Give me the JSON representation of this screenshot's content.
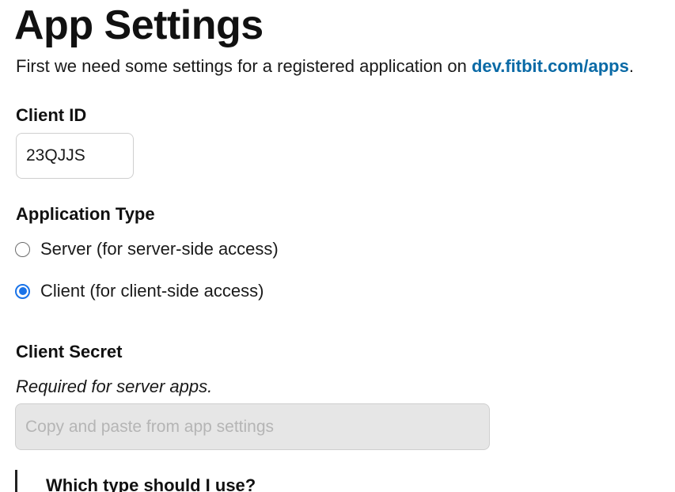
{
  "header": {
    "title": "App Settings",
    "intro_text": "First we need some settings for a registered application on ",
    "intro_link": "dev.fitbit.com/apps",
    "intro_suffix": "."
  },
  "client_id": {
    "label": "Client ID",
    "value": "23QJJS"
  },
  "application_type": {
    "label": "Application Type",
    "options": [
      {
        "label": "Server (for server-side access)",
        "checked": false
      },
      {
        "label": "Client (for client-side access)",
        "checked": true
      }
    ]
  },
  "client_secret": {
    "label": "Client Secret",
    "hint": "Required for server apps.",
    "placeholder": "Copy and paste from app settings",
    "value": ""
  },
  "callout": {
    "title": "Which type should I use?"
  },
  "colors": {
    "link": "#0a6aa6",
    "radio_accent": "#1a73e8",
    "disabled_input_bg": "#e6e6e6"
  }
}
